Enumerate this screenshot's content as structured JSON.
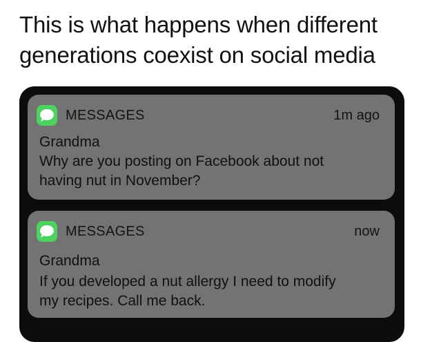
{
  "caption": {
    "line1": "This is what happens when different",
    "line2": "generations coexist on social media"
  },
  "colors": {
    "notification_bg": "#737373",
    "phone_bg": "#0c0c0c",
    "messages_icon": "#4bd25f"
  },
  "notifications": [
    {
      "app_icon": "messages-icon",
      "app_name": "MESSAGES",
      "time": "1m ago",
      "sender": "Grandma",
      "body_line1": "Why are you posting on Facebook about not",
      "body_line2": "having nut in November?"
    },
    {
      "app_icon": "messages-icon",
      "app_name": "MESSAGES",
      "time": "now",
      "sender": "Grandma",
      "body_line1": "If you developed a nut allergy I need to modify",
      "body_line2": "my recipes. Call me back."
    }
  ]
}
